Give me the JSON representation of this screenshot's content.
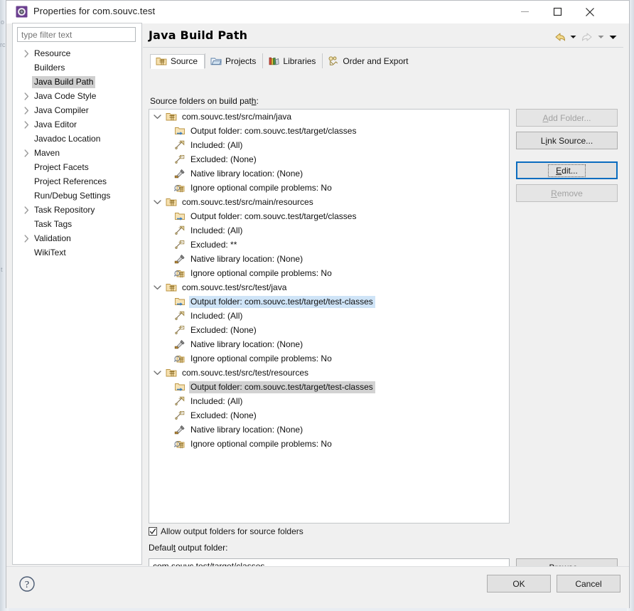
{
  "window": {
    "title": "Properties for com.souvc.test",
    "icon": "properties-icon",
    "minimize": "–",
    "maximize": "□",
    "close": "✕"
  },
  "sidebar": {
    "filter_placeholder": "type filter text",
    "filter_value": "",
    "items": [
      {
        "label": "Resource",
        "expandable": true,
        "selected": false
      },
      {
        "label": "Builders",
        "expandable": false,
        "selected": false
      },
      {
        "label": "Java Build Path",
        "expandable": false,
        "selected": true
      },
      {
        "label": "Java Code Style",
        "expandable": true,
        "selected": false
      },
      {
        "label": "Java Compiler",
        "expandable": true,
        "selected": false
      },
      {
        "label": "Java Editor",
        "expandable": true,
        "selected": false
      },
      {
        "label": "Javadoc Location",
        "expandable": false,
        "selected": false
      },
      {
        "label": "Maven",
        "expandable": true,
        "selected": false
      },
      {
        "label": "Project Facets",
        "expandable": false,
        "selected": false
      },
      {
        "label": "Project References",
        "expandable": false,
        "selected": false
      },
      {
        "label": "Run/Debug Settings",
        "expandable": false,
        "selected": false
      },
      {
        "label": "Task Repository",
        "expandable": true,
        "selected": false
      },
      {
        "label": "Task Tags",
        "expandable": false,
        "selected": false
      },
      {
        "label": "Validation",
        "expandable": true,
        "selected": false
      },
      {
        "label": "WikiText",
        "expandable": false,
        "selected": false
      }
    ]
  },
  "page": {
    "title": "Java Build Path",
    "section_label": "Source folders on build path:",
    "tabs": [
      {
        "label": "Source",
        "icon": "source-folder-icon",
        "active": true
      },
      {
        "label": "Projects",
        "icon": "projects-folder-icon",
        "active": false
      },
      {
        "label": "Libraries",
        "icon": "libraries-books-icon",
        "active": false
      },
      {
        "label": "Order and Export",
        "icon": "order-export-icon",
        "active": false
      }
    ],
    "nav": {
      "back_icon": "back-arrow-icon",
      "back_chevron_icon": "chevron-down-icon",
      "forward_icon": "forward-arrow-icon",
      "forward_chevron_icon": "chevron-down-icon",
      "menu_chevron_icon": "chevron-down-icon"
    }
  },
  "tree": {
    "groups": [
      {
        "label": "com.souvc.test/src/main/java",
        "icon": "source-folder-icon",
        "expanded": true,
        "children": [
          {
            "label": "Output folder: com.souvc.test/target/classes",
            "icon": "output-folder-icon",
            "highlight": "none"
          },
          {
            "label": "Included: (All)",
            "icon": "included-filter-icon",
            "highlight": "none"
          },
          {
            "label": "Excluded: (None)",
            "icon": "excluded-filter-icon",
            "highlight": "none"
          },
          {
            "label": "Native library location: (None)",
            "icon": "native-library-icon",
            "highlight": "none"
          },
          {
            "label": "Ignore optional compile problems: No",
            "icon": "compile-problems-icon",
            "highlight": "none"
          }
        ]
      },
      {
        "label": "com.souvc.test/src/main/resources",
        "icon": "source-folder-icon",
        "expanded": true,
        "children": [
          {
            "label": "Output folder: com.souvc.test/target/classes",
            "icon": "output-folder-icon",
            "highlight": "none"
          },
          {
            "label": "Included: (All)",
            "icon": "included-filter-icon",
            "highlight": "none"
          },
          {
            "label": "Excluded: **",
            "icon": "excluded-filter-icon",
            "highlight": "none"
          },
          {
            "label": "Native library location: (None)",
            "icon": "native-library-icon",
            "highlight": "none"
          },
          {
            "label": "Ignore optional compile problems: No",
            "icon": "compile-problems-icon",
            "highlight": "none"
          }
        ]
      },
      {
        "label": "com.souvc.test/src/test/java",
        "icon": "source-folder-icon",
        "expanded": true,
        "children": [
          {
            "label": "Output folder: com.souvc.test/target/test-classes",
            "icon": "output-folder-icon",
            "highlight": "blue"
          },
          {
            "label": "Included: (All)",
            "icon": "included-filter-icon",
            "highlight": "none"
          },
          {
            "label": "Excluded: (None)",
            "icon": "excluded-filter-icon",
            "highlight": "none"
          },
          {
            "label": "Native library location: (None)",
            "icon": "native-library-icon",
            "highlight": "none"
          },
          {
            "label": "Ignore optional compile problems: No",
            "icon": "compile-problems-icon",
            "highlight": "none"
          }
        ]
      },
      {
        "label": "com.souvc.test/src/test/resources",
        "icon": "source-folder-icon",
        "expanded": true,
        "children": [
          {
            "label": "Output folder: com.souvc.test/target/test-classes",
            "icon": "output-folder-icon",
            "highlight": "gray"
          },
          {
            "label": "Included: (All)",
            "icon": "included-filter-icon",
            "highlight": "none"
          },
          {
            "label": "Excluded: (None)",
            "icon": "excluded-filter-icon",
            "highlight": "none"
          },
          {
            "label": "Native library location: (None)",
            "icon": "native-library-icon",
            "highlight": "none"
          },
          {
            "label": "Ignore optional compile problems: No",
            "icon": "compile-problems-icon",
            "highlight": "none"
          }
        ]
      }
    ]
  },
  "side_buttons": [
    {
      "label": "Add Folder...",
      "mnemonic": "A",
      "state": "disabled"
    },
    {
      "label": "Link Source...",
      "mnemonic": "i",
      "state": "enabled"
    },
    {
      "label": "Edit...",
      "mnemonic": "E",
      "state": "focused"
    },
    {
      "label": "Remove",
      "mnemonic": "R",
      "state": "disabled"
    }
  ],
  "bottom": {
    "allow_output_checkbox": {
      "label": "Allow output folders for source folders",
      "checked": true,
      "mnemonic": "c"
    },
    "default_output_label": "Default output folder:",
    "default_output_value": "com.souvc.test/target/classes",
    "browse_label": "Browse...",
    "browse_mnemonic": "w"
  },
  "footer": {
    "help_icon": "help-question-icon",
    "ok_label": "OK",
    "cancel_label": "Cancel"
  },
  "colors": {
    "selection_blue": "#cfe4f7",
    "selection_gray": "#d2d2d2",
    "focus_blue": "#0a6cbf",
    "dialog_bg": "#f0f0f0",
    "button_bg": "#e1e1e1"
  }
}
